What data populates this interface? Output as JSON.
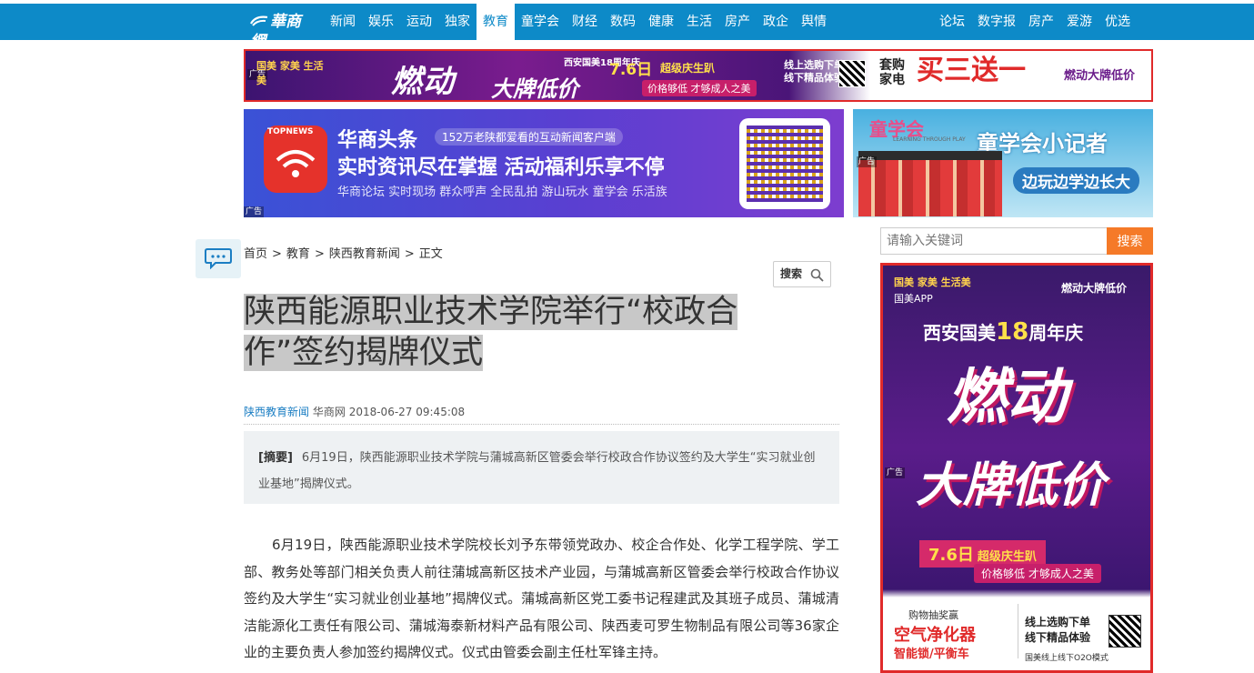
{
  "nav": {
    "logo_text": "華商網",
    "left_items": [
      "新闻",
      "娱乐",
      "运动",
      "独家",
      "教育",
      "童学会",
      "财经",
      "数码",
      "健康",
      "生活",
      "房产",
      "政企",
      "舆情"
    ],
    "active_index": 4,
    "right_items": [
      "论坛",
      "数字报",
      "房产",
      "爱游",
      "优选"
    ]
  },
  "ads": {
    "tag": "广告",
    "top_banner": {
      "brand": "国美 家美 生活美",
      "headline_1": "燃动",
      "headline_2": "大牌低价",
      "anniversary": "西安国美18周年庆",
      "date": "7.6日",
      "date_sub": "超级庆生趴",
      "sub": "价格够低 才够成人之美",
      "online": "线上选购下单 线下精品体验",
      "promo_prefix": "套购家电",
      "promo_main": "买三送一",
      "promo_right": "燃动大牌低价"
    },
    "topnews": {
      "app_label": "TOPNEWS",
      "title": "华商头条",
      "tagline": "152万老陕都爱看的互动新闻客户端",
      "slogan": "实时资讯尽在掌握 活动福利乐享不停",
      "features": "华商论坛 实时现场 群众呼声 全民乱拍 游山玩水 童学会 乐活族"
    },
    "kids": {
      "logo": "童学会",
      "logo_sub": "LEARNING THROUGH PLAY",
      "title": "童学会小记者",
      "sub": "边玩边学边长大"
    },
    "side": {
      "brand": "国美 家美 生活美",
      "brand_sub": "国美APP",
      "right_tag": "燃动大牌低价",
      "anniv_prefix": "西安国美",
      "anniv_num": "18",
      "anniv_suffix": "周年庆",
      "ran": "燃动",
      "dapai": "大牌低价",
      "date": "7.6日",
      "date_sub": "超级庆生趴",
      "sub": "价格够低 才够成人之美",
      "bottom_l1": "购物抽奖赢",
      "bottom_l2": "空气净化器",
      "bottom_l3": "智能锁/平衡车",
      "bottom_r1": "线上选购下单",
      "bottom_r2": "线下精品体验",
      "bottom_r3": "国美线上线下O2O模式"
    }
  },
  "breadcrumb": {
    "items": [
      "首页",
      "教育",
      "陕西教育新闻",
      "正文"
    ],
    "sep": ">"
  },
  "search_small": {
    "label": "搜索"
  },
  "article": {
    "title": "陕西能源职业技术学院举行“校政合作”签约揭牌仪式",
    "source_link": "陕西教育新闻",
    "publisher": "华商网",
    "datetime": "2018-06-27 09:45:08",
    "summary_label": "[摘要]",
    "summary": "6月19日，陕西能源职业技术学院与蒲城高新区管委会举行校政合作协议签约及大学生“实习就业创业基地”揭牌仪式。",
    "body": "6月19日，陕西能源职业技术学院校长刘予东带领党政办、校企合作处、化学工程学院、学工部、教务处等部门相关负责人前往蒲城高新区技术产业园，与蒲城高新区管委会举行校政合作协议签约及大学生“实习就业创业基地”揭牌仪式。蒲城高新区党工委书记程建武及其班子成员、蒲城清洁能源化工责任有限公司、蒲城海泰新材料产品有限公司、陕西麦可罗生物制品有限公司等36家企业的主要负责人参加签约揭牌仪式。仪式由管委会副主任杜军锋主持。"
  },
  "right_search": {
    "placeholder": "请输入关键词",
    "button": "搜索"
  }
}
